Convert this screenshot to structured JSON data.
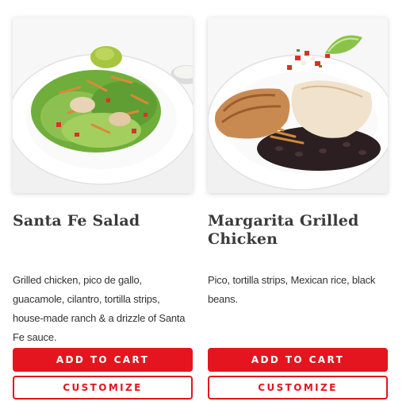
{
  "colors": {
    "accent": "#e4151f",
    "title_text": "#3a3a3a",
    "body_text": "#333333"
  },
  "items": [
    {
      "name": "Santa Fe Salad",
      "description": "Grilled chicken, pico de gallo, guacamole, cilantro, tortilla strips, house-made ranch & a drizzle of Santa Fe sauce.",
      "add_label": "ADD TO CART",
      "customize_label": "CUSTOMIZE"
    },
    {
      "name": "Margarita Grilled Chicken",
      "description": "Pico, tortilla strips, Mexican rice, black beans.",
      "add_label": "ADD TO CART",
      "customize_label": "CUSTOMIZE"
    }
  ]
}
